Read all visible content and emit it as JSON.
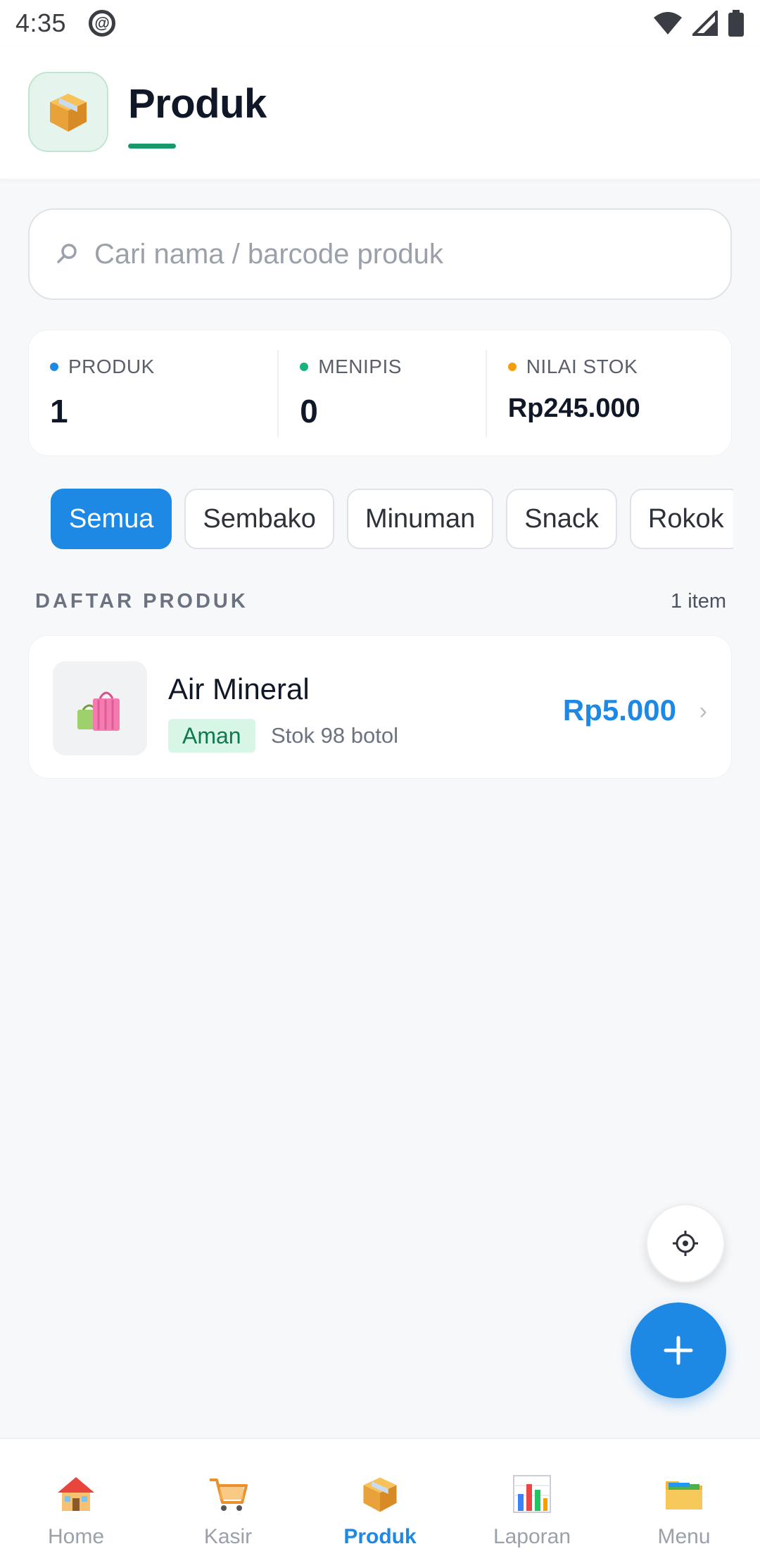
{
  "status_bar": {
    "time": "4:35",
    "icons": [
      "at-sign-icon",
      "wifi-icon",
      "signal-icon",
      "battery-icon"
    ]
  },
  "header": {
    "title": "Produk",
    "icon": "package-box-icon",
    "accent_color": "#17996a"
  },
  "search": {
    "placeholder": "Cari nama / barcode produk",
    "value": ""
  },
  "stats": [
    {
      "label": "PRODUK",
      "value": "1",
      "dot_color": "#1e88e5"
    },
    {
      "label": "MENIPIS",
      "value": "0",
      "dot_color": "#17b37b"
    },
    {
      "label": "NILAI STOK",
      "value": "Rp245.000",
      "dot_color": "#f59e0b"
    }
  ],
  "categories": {
    "items": [
      "Semua",
      "Sembako",
      "Minuman",
      "Snack",
      "Rokok"
    ],
    "selected": "Semua"
  },
  "section": {
    "title": "DAFTAR PRODUK",
    "count": "1 item"
  },
  "products": [
    {
      "name": "Air Mineral",
      "status": "Aman",
      "stock": "Stok 98 botol",
      "price": "Rp5.000",
      "icon": "shopping-bags-icon"
    }
  ],
  "fab": {
    "scan_icon": "target-icon",
    "add_icon": "plus-icon"
  },
  "bottom_nav": {
    "items": [
      {
        "label": "Home",
        "icon": "house-icon"
      },
      {
        "label": "Kasir",
        "icon": "shopping-cart-icon"
      },
      {
        "label": "Produk",
        "icon": "package-box-icon"
      },
      {
        "label": "Laporan",
        "icon": "bar-chart-icon"
      },
      {
        "label": "Menu",
        "icon": "folder-icon"
      }
    ],
    "active": "Produk"
  },
  "colors": {
    "primary": "#1e88e5",
    "success_bg": "#d8f6e5",
    "success_text": "#0f7a4c"
  }
}
